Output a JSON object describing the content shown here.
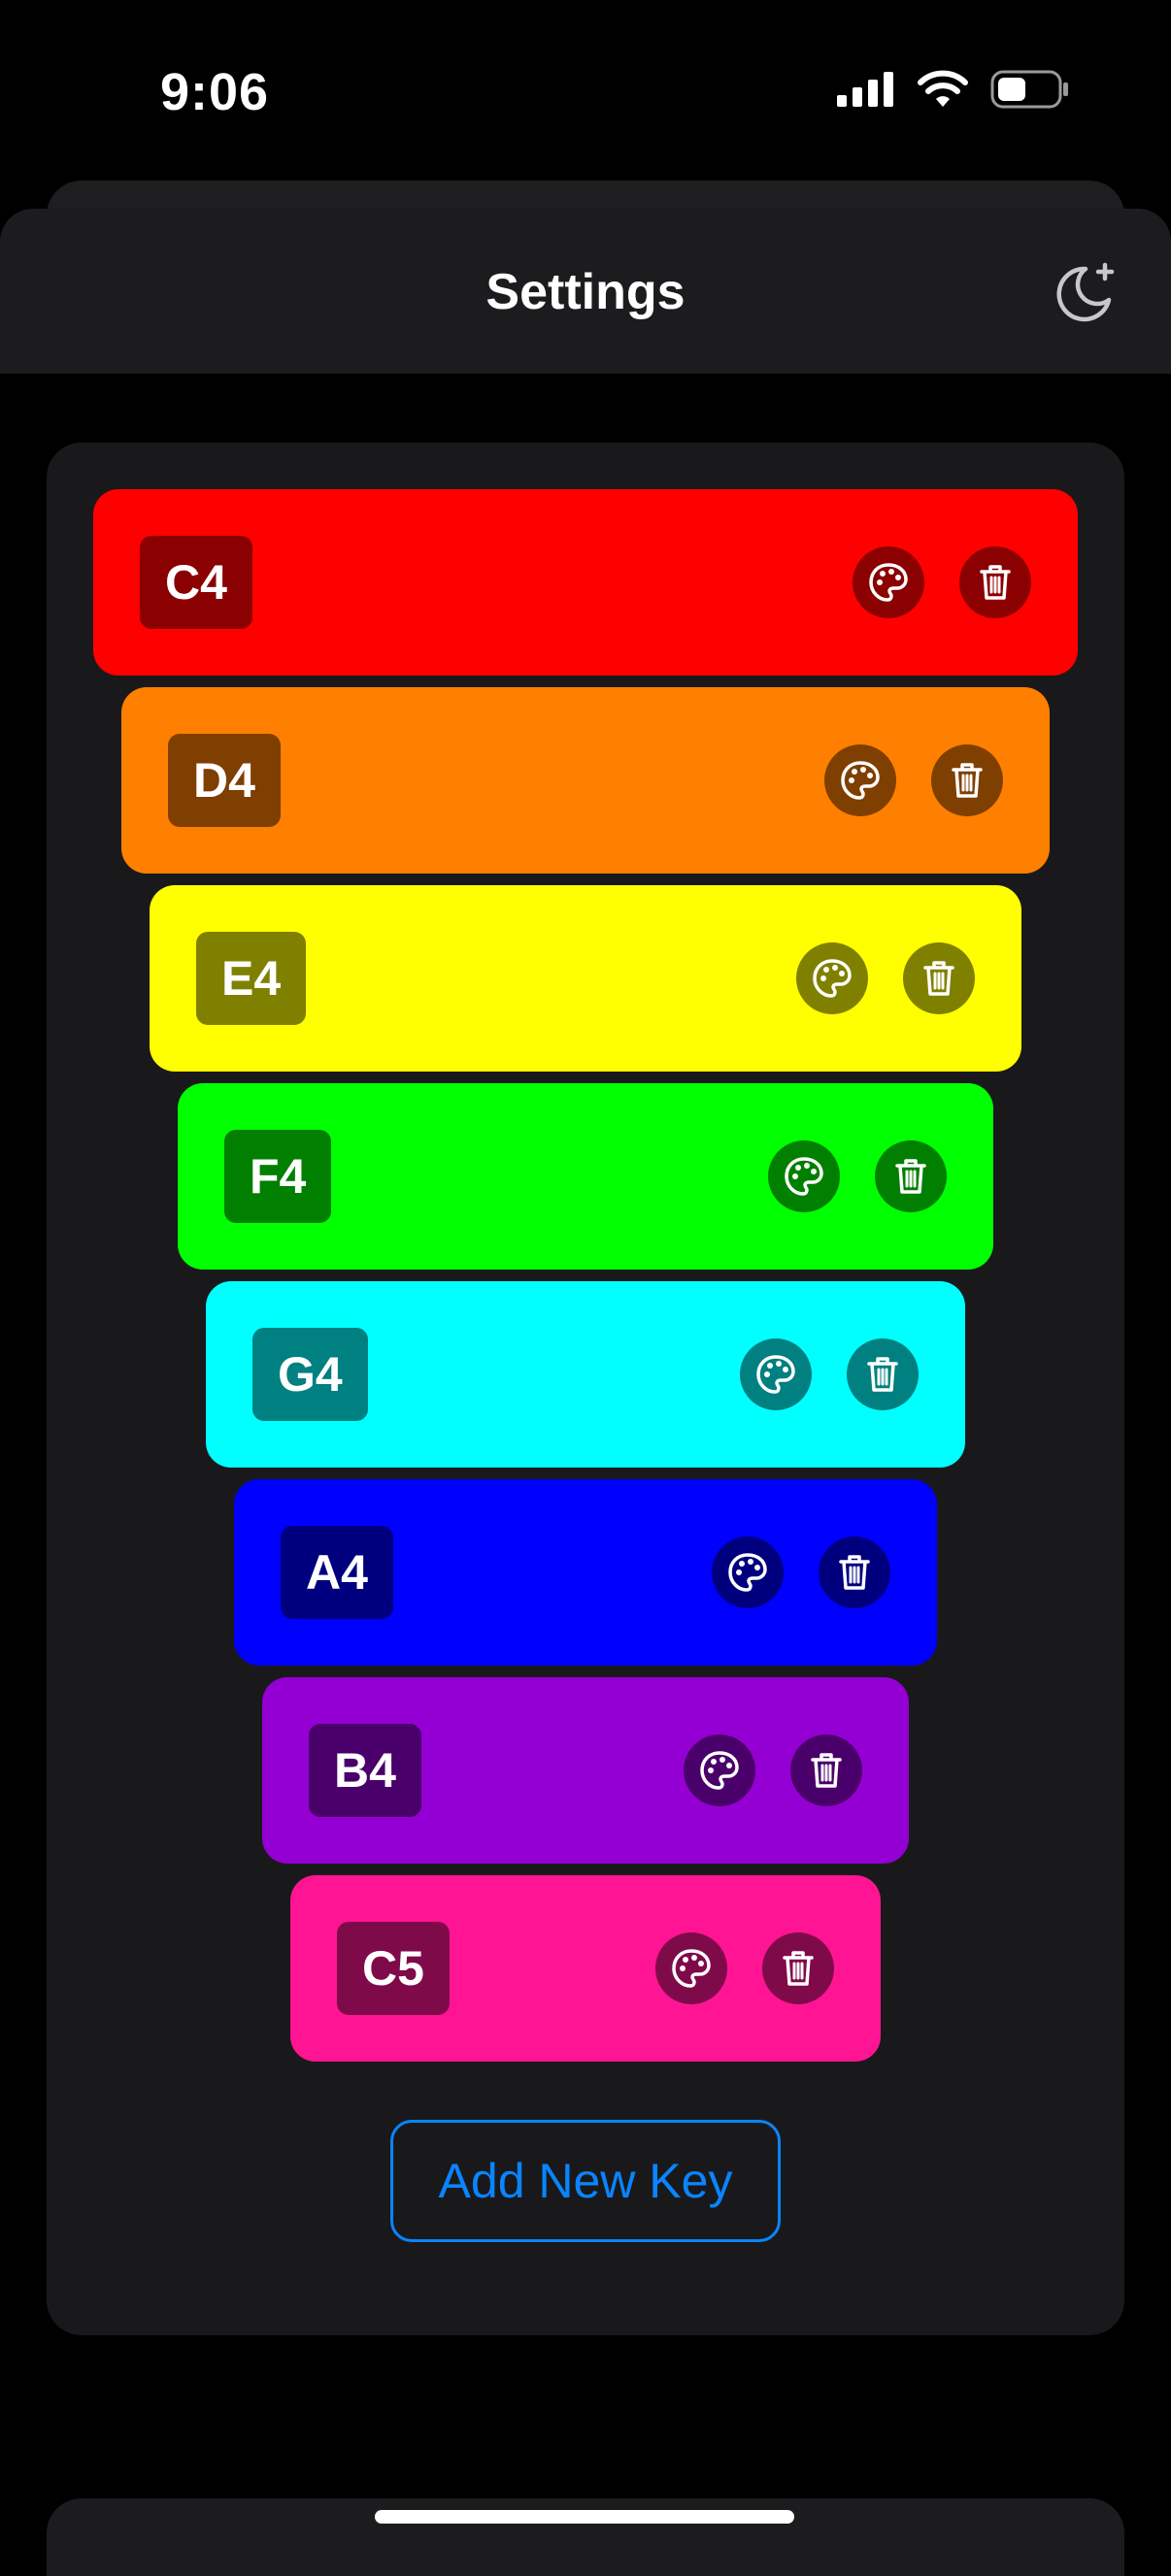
{
  "status_bar": {
    "time": "9:06"
  },
  "header": {
    "title": "Settings",
    "theme_icon": "moon-sparkle-icon"
  },
  "keys": [
    {
      "label": "C4",
      "color": "#ff0000",
      "label_bg": "#8b0000",
      "btn_bg": "#8b0000"
    },
    {
      "label": "D4",
      "color": "#ff7f00",
      "label_bg": "#7f3f00",
      "btn_bg": "#7f3f00"
    },
    {
      "label": "E4",
      "color": "#ffff00",
      "label_bg": "#808000",
      "btn_bg": "#808000"
    },
    {
      "label": "F4",
      "color": "#00ff00",
      "label_bg": "#007f00",
      "btn_bg": "#007f00"
    },
    {
      "label": "G4",
      "color": "#00ffff",
      "label_bg": "#008080",
      "btn_bg": "#008080"
    },
    {
      "label": "A4",
      "color": "#0000ff",
      "label_bg": "#00007f",
      "btn_bg": "#00007f"
    },
    {
      "label": "B4",
      "color": "#9400d3",
      "label_bg": "#4a006a",
      "btn_bg": "#4a006a"
    },
    {
      "label": "C5",
      "color": "#ff1493",
      "label_bg": "#7f0a4a",
      "btn_bg": "#7f0a4a"
    }
  ],
  "add_button": {
    "label": "Add New Key"
  },
  "colors": {
    "accent": "#0a84ff",
    "panel": "#19191b",
    "background": "#000000"
  }
}
